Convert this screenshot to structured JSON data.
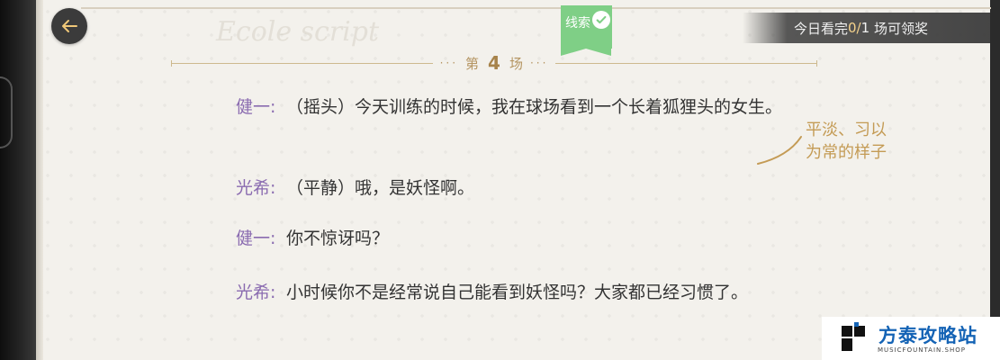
{
  "header": {
    "clue_tag": "线索",
    "daily_reward": {
      "prefix": "今日看完 ",
      "progress": "0/",
      "total": "1",
      "suffix": " 场可领奖"
    }
  },
  "scene": {
    "prefix": "第",
    "number": "4",
    "suffix": "场",
    "dots": "···"
  },
  "dialogue": [
    {
      "speaker": "健一:",
      "line": "（摇头）今天训练的时候，我在球场看到一个长着狐狸头的女生。"
    },
    {
      "speaker": "光希:",
      "line": "（平静）哦，是妖怪啊。"
    },
    {
      "speaker": "健一:",
      "line": "你不惊讶吗？"
    },
    {
      "speaker": "光希:",
      "line": "小时候你不是经常说自己能看到妖怪吗？大家都已经习惯了。"
    }
  ],
  "annotation": {
    "line1": "平淡、习以",
    "line2": "为常的样子"
  },
  "watermark_logo": {
    "name": "方泰攻略站",
    "sub": "MUSICFOUNTAIN.SHOP"
  },
  "colors": {
    "speaker": "#8a6bb0",
    "accent_gold": "#b59562",
    "clue_green": "#7fcf86",
    "logo_blue": "#1463b5"
  },
  "icons": {
    "back": "arrow-left-icon",
    "clue_done": "checkmark-icon",
    "annotation": "pen-stroke-icon",
    "logo": "logo-mark-icon"
  }
}
